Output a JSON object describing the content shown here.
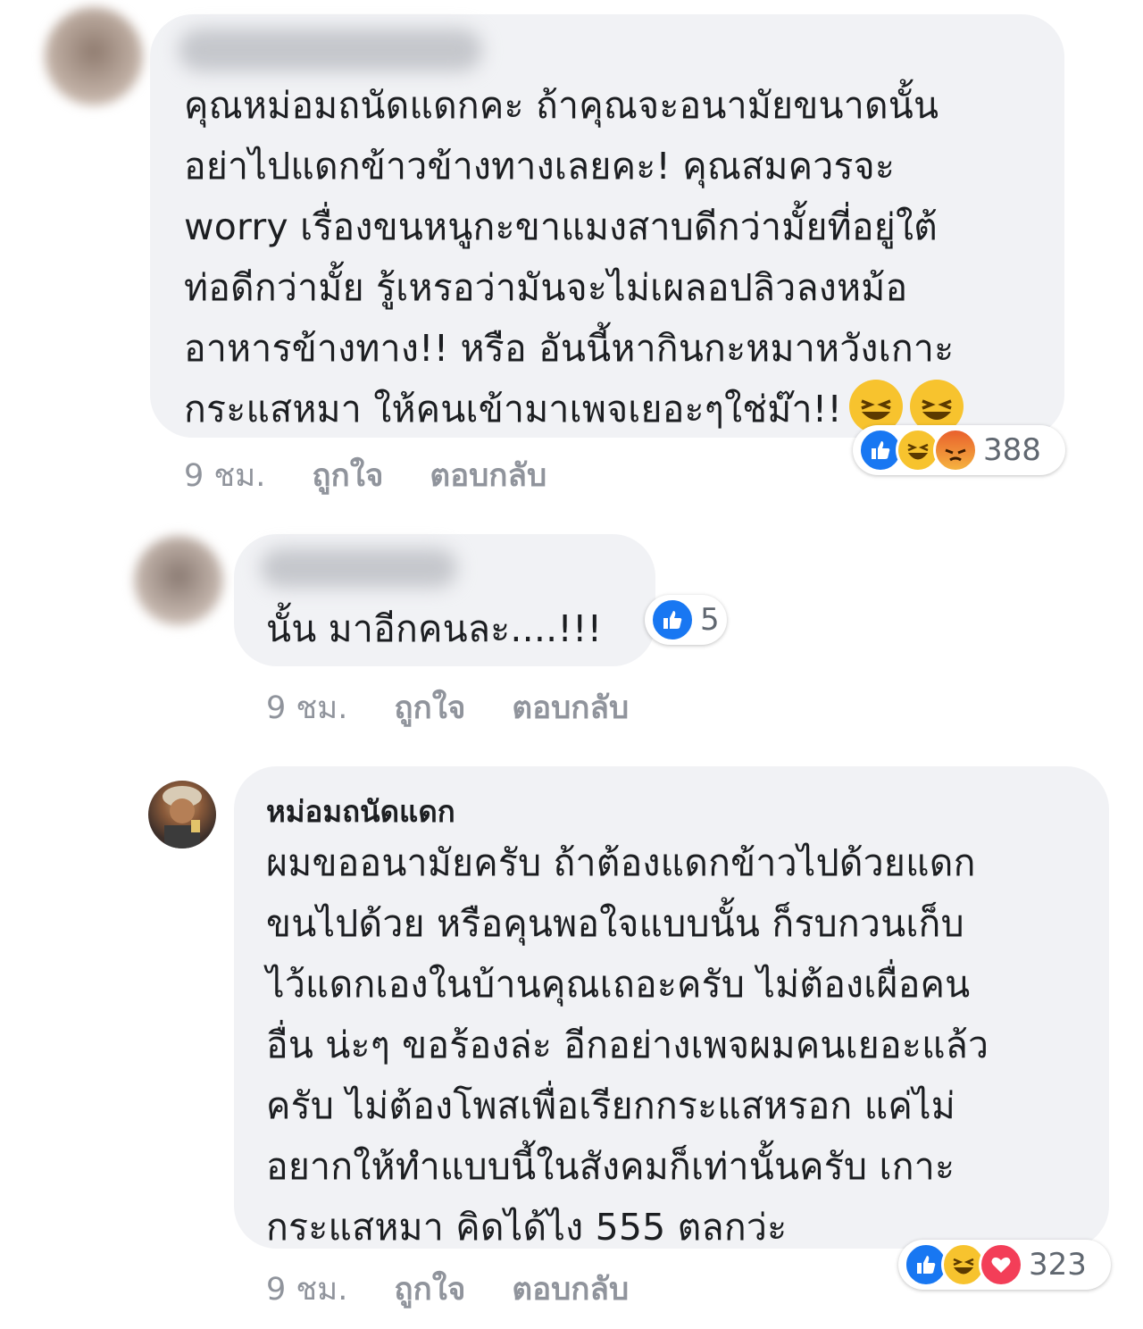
{
  "comments": [
    {
      "author_visible": false,
      "lines": [
        "คุณหม่อมถนัดแดกคะ ถ้าคุณจะอนามัยขนาดนั้น",
        "อย่าไปแดกข้าวข้างทางเลยคะ! คุณสมควรจะ",
        "worry เรื่องขนหนูกะขาแมงสาบดีกว่ามั้ยที่อยู่ใต้",
        "ท่อดีกว่ามั้ย รู้เหรอว่ามันจะไม่เผลอปลิวลงหม้อ",
        "อาหารข้างทาง!! หรือ อันนี้หากินกะหมาหวังเกาะ",
        "กระแสหมา ให้คนเข้ามาเพจเยอะๆใช่ม๊า!!"
      ],
      "reactions": [
        "like",
        "haha",
        "angry"
      ],
      "reaction_count": "388",
      "time": "9 ชม.",
      "like_label": "ถูกใจ",
      "reply_label": "ตอบกลับ"
    },
    {
      "author_visible": false,
      "lines": [
        "นั้น มาอีกคนละ....!!!"
      ],
      "reactions": [
        "like"
      ],
      "reaction_count": "5",
      "time": "9 ชม.",
      "like_label": "ถูกใจ",
      "reply_label": "ตอบกลับ"
    },
    {
      "author": "หม่อมถนัดแดก",
      "lines": [
        "ผมขออนามัยครับ ถ้าต้องแดกข้าวไปด้วยแดก",
        "ขนไปด้วย หรือคุนพอใจแบบนั้น ก็รบกวนเก็บ",
        "ไว้แดกเองในบ้านคุณเถอะครับ ไม่ต้องเผื่อคน",
        "อื่น น่ะๆ ขอร้องล่ะ อีกอย่างเพจผมคนเยอะแล้ว",
        "ครับ ไม่ต้องโพสเพื่อเรียกกระแสหรอก แค่ไม่",
        "อยากให้ทำแบบนี้ในสังคมก็เท่านั้นครับ เกาะ",
        "กระแสหมา คิดได้ไง 555 ตลกว่ะ"
      ],
      "reactions": [
        "like",
        "haha",
        "love"
      ],
      "reaction_count": "323",
      "time": "9 ชม.",
      "like_label": "ถูกใจ",
      "reply_label": "ตอบกลับ"
    }
  ],
  "colors": {
    "bubble": "#f1f2f5",
    "meta": "#90949c",
    "like": "#1877f2",
    "haha": "#f7c32e",
    "love": "#f33e58",
    "angry": "#e9602c"
  }
}
